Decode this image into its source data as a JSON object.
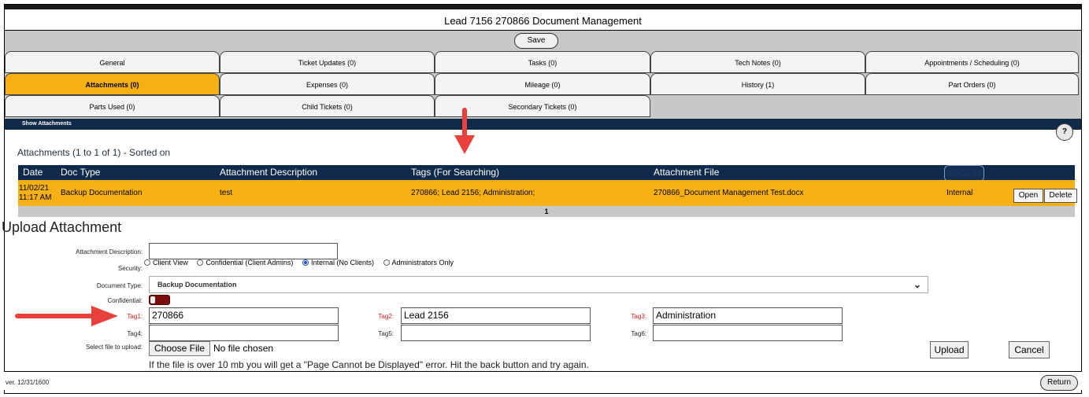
{
  "window": {
    "title": "Lead 7156 270866 Document Management"
  },
  "toolbar": {
    "save_label": "Save"
  },
  "tabs": [
    {
      "label": "General",
      "active": false
    },
    {
      "label": "Ticket Updates (0)",
      "active": false
    },
    {
      "label": "Tasks (0)",
      "active": false
    },
    {
      "label": "Tech Notes (0)",
      "active": false
    },
    {
      "label": "Appointments / Scheduling (0)",
      "active": false
    },
    {
      "label": "Attachments (0)",
      "active": true
    },
    {
      "label": "Expenses (0)",
      "active": false
    },
    {
      "label": "Mileage (0)",
      "active": false
    },
    {
      "label": "History (1)",
      "active": false
    },
    {
      "label": "Part Orders (0)",
      "active": false
    },
    {
      "label": "Parts Used (0)",
      "active": false
    },
    {
      "label": "Child Tickets (0)",
      "active": false
    },
    {
      "label": "Secondary Tickets (0)",
      "active": false
    }
  ],
  "attachments": {
    "section_bar": "Show Attachments",
    "help_label": "?",
    "heading": "Attachments (1 to 1 of 1) - Sorted on",
    "columns": {
      "date": "Date",
      "doc_type": "Doc Type",
      "description": "Attachment Description",
      "tags": "Tags (For Searching)",
      "file": "Attachment File",
      "security": "Security"
    },
    "rows": [
      {
        "date_line1": "11/02/21",
        "date_line2": "11:17 AM",
        "doc_type": "Backup Documentation",
        "description": "test",
        "tags": "270866; Lead 2156; Administration;",
        "file": "270866_Document Management Test.docx",
        "security": "Internal",
        "open_label": "Open",
        "delete_label": "Delete"
      }
    ],
    "page": "1"
  },
  "upload": {
    "title": "Upload Attachment",
    "description_label": "Attachment Description:",
    "description_value": "",
    "security_label": "Security:",
    "security_options": [
      "Client View",
      "Confidential (Client Admins)",
      "Internal (No Clients)",
      "Administrators Only"
    ],
    "security_selected": "Internal (No Clients)",
    "doctype_label": "Document Type:",
    "doctype_value": "Backup Documentation",
    "confidential_label": "Confidential:",
    "tag1_label": "Tag1:",
    "tag1_value": "270866",
    "tag2_label": "Tag2:",
    "tag2_value": "Lead 2156",
    "tag3_label": "Tag3:",
    "tag3_value": "Administration",
    "tag4_label": "Tag4:",
    "tag4_value": "",
    "tag5_label": "Tag5:",
    "tag5_value": "",
    "tag6_label": "Tag6:",
    "tag6_value": "",
    "file_label": "Select file to upload:",
    "choose_file_label": "Choose File",
    "no_file_text": "No file chosen",
    "warning": "If the file is over 10 mb you will get a \"Page Cannot be Displayed\" error. Hit the back button and try again.",
    "upload_label": "Upload",
    "cancel_label": "Cancel"
  },
  "footer": {
    "version": "ver. 12/31/1600",
    "return_label": "Return"
  },
  "colors": {
    "accent": "#f7b011",
    "navy": "#0f2a4a",
    "tab_bg": "#c8c8c8",
    "arrow": "#e8403a",
    "toggle": "#7b0d0d"
  }
}
